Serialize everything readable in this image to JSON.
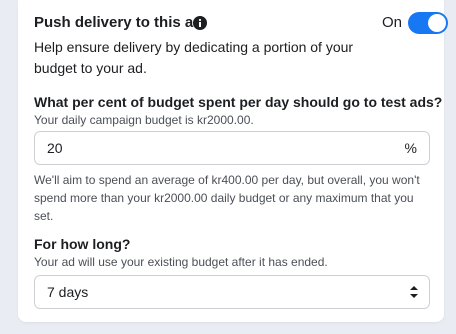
{
  "push_delivery": {
    "title": "Push delivery to this ad",
    "toggle_label": "On",
    "toggle_state": "on",
    "description": "Help ensure delivery by dedicating a portion of your budget to your ad."
  },
  "test_budget": {
    "question": "What per cent of budget spent per day should go to test ads?",
    "hint": "Your daily campaign budget is kr2000.00.",
    "value": "20",
    "suffix": "%",
    "note": "We'll aim to spend an average of kr400.00 per day, but overall, you won't spend more than your kr2000.00 daily budget or any maximum that you set."
  },
  "duration": {
    "question": "For how long?",
    "hint": "Your ad will use your existing budget after it has ended.",
    "selected": "7 days"
  },
  "colors": {
    "accent": "#1877f2",
    "text": "#1c1e21",
    "secondary_text": "#4b4f56",
    "border": "#ccd0d5"
  }
}
